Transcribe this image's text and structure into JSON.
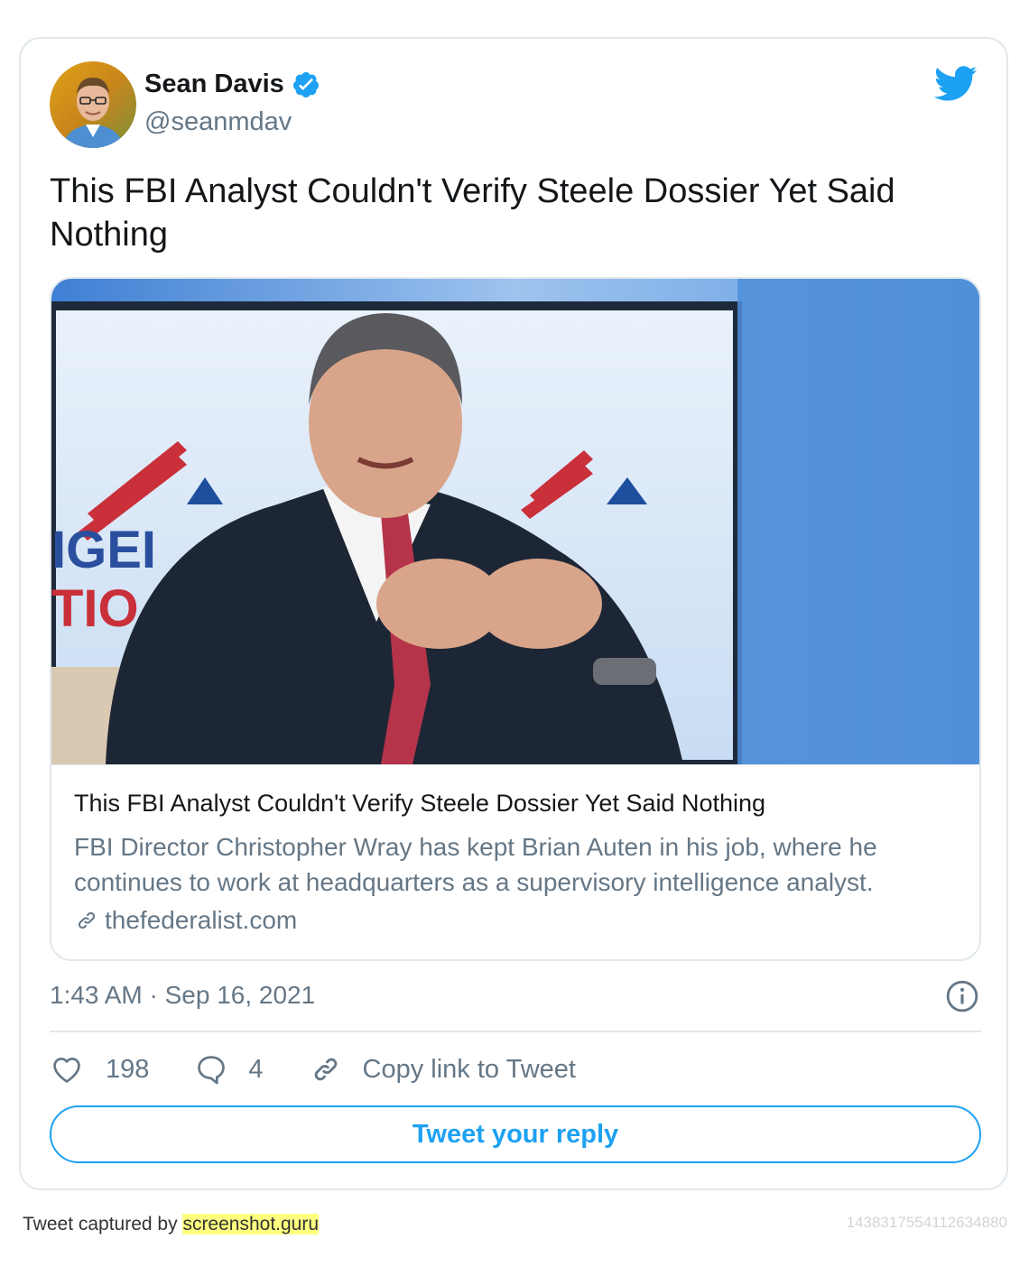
{
  "author": {
    "name": "Sean Davis",
    "handle": "@seanmdav"
  },
  "tweet": {
    "text": "This FBI Analyst Couldn't Verify Steele Dossier Yet Said Nothing",
    "timestamp": "1:43 AM · Sep 16, 2021"
  },
  "link_card": {
    "title": "This FBI Analyst Couldn't Verify Steele Dossier Yet Said Nothing",
    "description": "FBI Director Christopher Wray has kept Brian Auten in his job, where he continues to work at headquarters as a supervisory intelligence analyst.",
    "domain": "thefederalist.com"
  },
  "actions": {
    "likes": "198",
    "replies": "4",
    "copy_link": "Copy link to Tweet",
    "reply_button": "Tweet your reply"
  },
  "footer": {
    "captured_by": "Tweet captured by ",
    "service": "screenshot.guru",
    "tweet_id": "1438317554112634880"
  },
  "colors": {
    "twitter_blue": "#1da1f2",
    "secondary_text": "#657786",
    "border": "#e1e8ed"
  }
}
